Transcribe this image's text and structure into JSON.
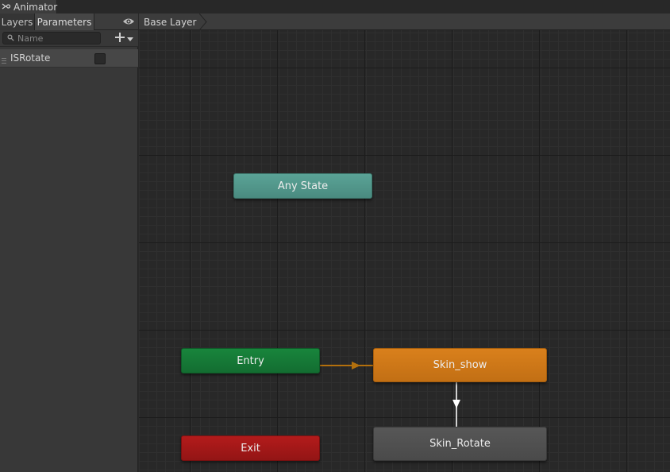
{
  "window": {
    "title": "Animator"
  },
  "sidebar": {
    "tabs": [
      {
        "label": "Layers"
      },
      {
        "label": "Parameters"
      }
    ],
    "search": {
      "placeholder": "Name",
      "value": ""
    },
    "parameters": [
      {
        "name": "ISRotate",
        "type": "bool",
        "value": false
      }
    ]
  },
  "breadcrumb": {
    "layer": "Base Layer"
  },
  "graph": {
    "states": {
      "any_state": "Any State",
      "entry": "Entry",
      "exit": "Exit",
      "skin_show": "Skin_show",
      "skin_rotate": "Skin_Rotate"
    },
    "transitions": [
      {
        "from": "Entry",
        "to": "Skin_show",
        "kind": "default"
      },
      {
        "from": "Skin_show",
        "to": "Skin_Rotate",
        "kind": "normal"
      }
    ]
  },
  "colors": {
    "any_state": "#4f9489",
    "entry": "#157a36",
    "exit": "#a31818",
    "default_state": "#cc7618",
    "state": "#505050",
    "default_transition": "#b3700d",
    "transition": "#d0d0d0"
  },
  "icons": {
    "window": "animator-icon",
    "visibility": "eye-icon",
    "search": "search-icon",
    "add": "plus-icon",
    "dropdown": "chevron-down-icon",
    "drag": "drag-handle-icon"
  }
}
